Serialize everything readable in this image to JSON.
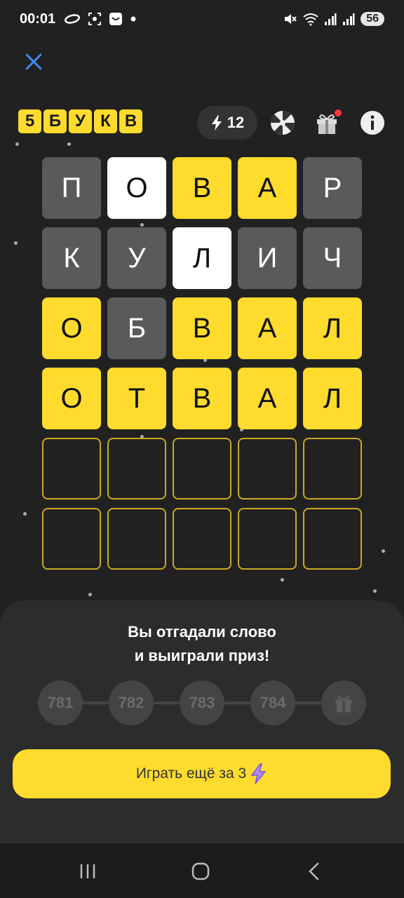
{
  "status_bar": {
    "time": "00:01",
    "battery": "56",
    "icons": [
      "cloud-icon",
      "screenshot-icon",
      "shop-icon",
      "dot-icon",
      "mute-icon",
      "wifi-icon",
      "signal-icon",
      "signal-icon"
    ]
  },
  "header": {
    "close_icon": "close-icon",
    "logo_letters": [
      "5",
      "Б",
      "У",
      "К",
      "В"
    ],
    "energy_count": "12",
    "icons": [
      "wheel-icon",
      "gift-icon",
      "info-icon"
    ]
  },
  "colors": {
    "yellow": "#ffdb2e",
    "gray": "#5a5a5a",
    "white": "#ffffff",
    "background": "#212121"
  },
  "board": {
    "rows": [
      [
        {
          "l": "П",
          "s": "gray"
        },
        {
          "l": "О",
          "s": "white"
        },
        {
          "l": "В",
          "s": "yellow"
        },
        {
          "l": "А",
          "s": "yellow"
        },
        {
          "l": "Р",
          "s": "gray"
        }
      ],
      [
        {
          "l": "К",
          "s": "gray"
        },
        {
          "l": "У",
          "s": "gray"
        },
        {
          "l": "Л",
          "s": "white"
        },
        {
          "l": "И",
          "s": "gray"
        },
        {
          "l": "Ч",
          "s": "gray"
        }
      ],
      [
        {
          "l": "О",
          "s": "yellow"
        },
        {
          "l": "Б",
          "s": "gray"
        },
        {
          "l": "В",
          "s": "yellow"
        },
        {
          "l": "А",
          "s": "yellow"
        },
        {
          "l": "Л",
          "s": "yellow"
        }
      ],
      [
        {
          "l": "О",
          "s": "yellow"
        },
        {
          "l": "Т",
          "s": "yellow"
        },
        {
          "l": "В",
          "s": "yellow"
        },
        {
          "l": "А",
          "s": "yellow"
        },
        {
          "l": "Л",
          "s": "yellow"
        }
      ],
      [
        {
          "l": "",
          "s": "empty"
        },
        {
          "l": "",
          "s": "empty"
        },
        {
          "l": "",
          "s": "empty"
        },
        {
          "l": "",
          "s": "empty"
        },
        {
          "l": "",
          "s": "empty"
        }
      ],
      [
        {
          "l": "",
          "s": "empty"
        },
        {
          "l": "",
          "s": "empty"
        },
        {
          "l": "",
          "s": "empty"
        },
        {
          "l": "",
          "s": "empty"
        },
        {
          "l": "",
          "s": "empty"
        }
      ]
    ]
  },
  "result": {
    "title_line1": "Вы отгадали слово",
    "title_line2": "и выиграли приз!",
    "progress": [
      "781",
      "782",
      "783",
      "784"
    ],
    "progress_end_icon": "gift-icon",
    "play_button": "Играть ещё за 3"
  },
  "navbar": {
    "icons": [
      "recents-icon",
      "home-icon",
      "back-icon"
    ]
  }
}
